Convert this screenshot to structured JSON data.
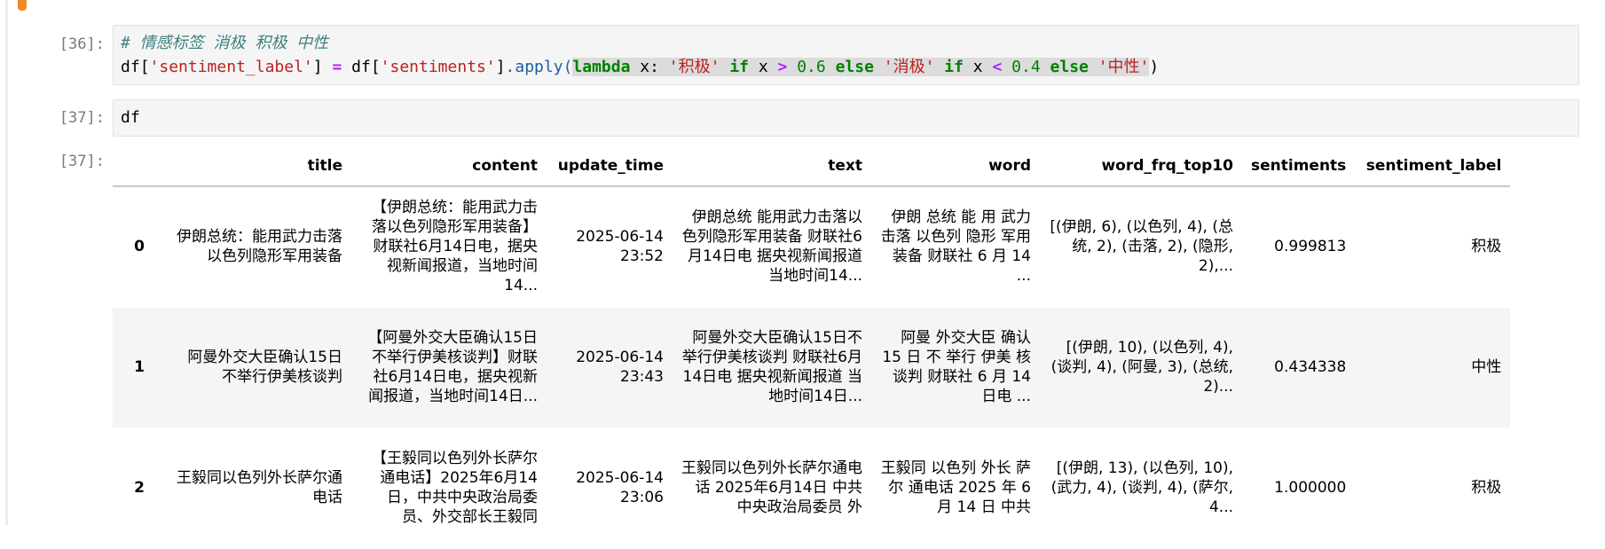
{
  "cells": [
    {
      "prompt": "[36]:",
      "comment": "# 情感标签 消极 积极 中性",
      "tokens": {
        "df": "df",
        "lb": "[",
        "col1": "'sentiment_label'",
        "rb": "]",
        "eq": " = ",
        "df2": "df",
        "col2": "'sentiments'",
        "apply": ".apply(",
        "lambda": "lambda",
        "x": " x: ",
        "pos": "'积极'",
        "if1": " if ",
        "x2": "x ",
        "gt": ">",
        "n1": " 0.6 ",
        "else1": "else",
        "neg": " '消极'",
        "if2": " if ",
        "x3": "x ",
        "lt": "<",
        "n2": " 0.4 ",
        "else2": "else",
        "neu": " '中性'",
        "close": ")"
      }
    },
    {
      "prompt": "[37]:",
      "code": "df"
    }
  ],
  "output": {
    "prompt": "[37]:",
    "columns": [
      "",
      "title",
      "content",
      "update_time",
      "text",
      "word",
      "word_frq_top10",
      "sentiments",
      "sentiment_label"
    ],
    "rows": [
      {
        "index": "0",
        "title": "伊朗总统：能用武力击落以色列隐形军用装备",
        "content": "【伊朗总统：能用武力击落以色列隐形军用装备】财联社6月14日电，据央视新闻报道，当地时间14...",
        "update_time": "2025-06-14 23:52",
        "text": "伊朗总统 能用武力击落以色列隐形军用装备 财联社6月14日电 据央视新闻报道 当地时间14...",
        "word": "伊朗 总统 能 用 武力 击落 以色列 隐形 军用 装备 财联社 6 月 14 ...",
        "word_frq_top10": "[(伊朗, 6), (以色列, 4), (总统, 2), (击落, 2), (隐形, 2),...",
        "sentiments": "0.999813",
        "sentiment_label": "积极"
      },
      {
        "index": "1",
        "title": "阿曼外交大臣确认15日不举行伊美核谈判",
        "content": "【阿曼外交大臣确认15日不举行伊美核谈判】财联社6月14日电，据央视新闻报道，当地时间14日...",
        "update_time": "2025-06-14 23:43",
        "text": "阿曼外交大臣确认15日不举行伊美核谈判 财联社6月14日电 据央视新闻报道 当地时间14日...",
        "word": "阿曼 外交大臣 确认 15 日 不 举行 伊美 核 谈判 财联社 6 月 14 日电 ...",
        "word_frq_top10": "[(伊朗, 10), (以色列, 4), (谈判, 4), (阿曼, 3), (总统, 2)...",
        "sentiments": "0.434338",
        "sentiment_label": "中性"
      },
      {
        "index": "2",
        "title": "王毅同以色列外长萨尔通电话",
        "content": "【王毅同以色列外长萨尔通电话】2025年6月14日，中共中央政治局委员、外交部长王毅同",
        "update_time": "2025-06-14 23:06",
        "text": "王毅同以色列外长萨尔通电话 2025年6月14日 中共中央政治局委员 外",
        "word": "王毅同 以色列 外长 萨尔 通电话 2025 年 6 月 14 日 中共",
        "word_frq_top10": "[(伊朗, 13), (以色列, 10), (武力, 4), (谈判, 4), (萨尔, 4...",
        "sentiments": "1.000000",
        "sentiment_label": "积极"
      }
    ]
  }
}
